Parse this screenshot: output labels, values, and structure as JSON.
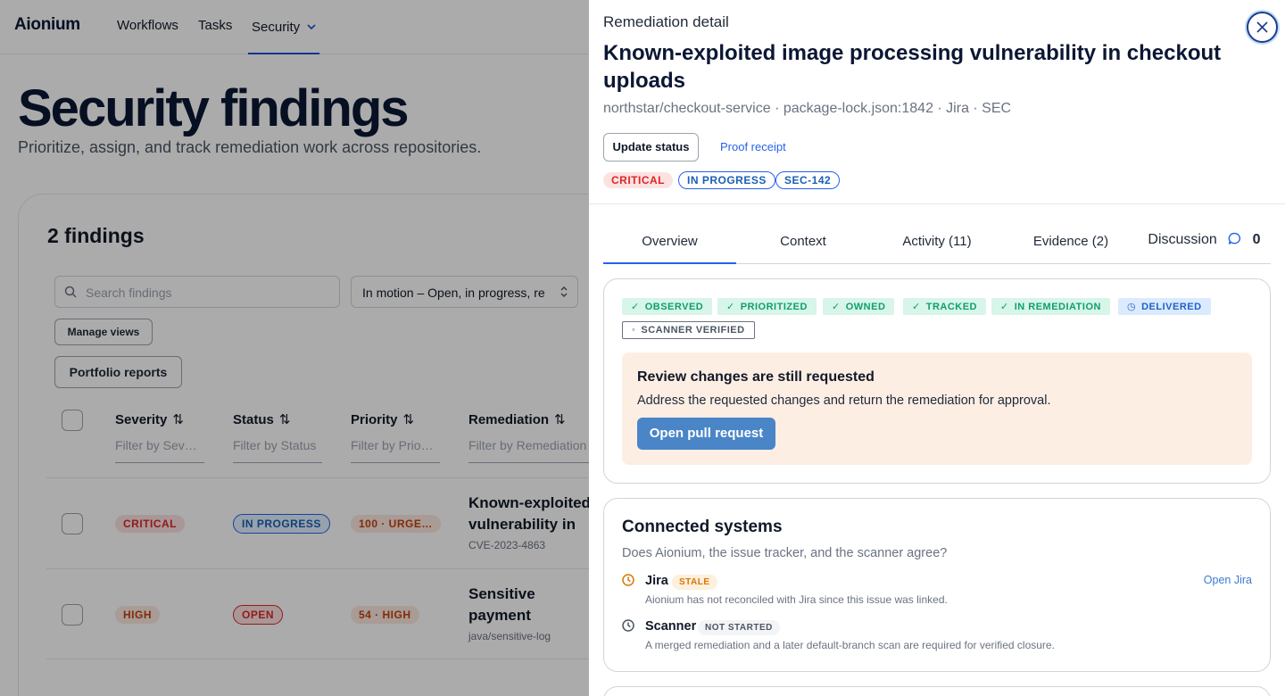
{
  "app": {
    "brand": "Aionium"
  },
  "nav": {
    "workflows": "Workflows",
    "tasks": "Tasks",
    "security": "Security"
  },
  "page": {
    "title": "Security findings",
    "subtitle": "Prioritize, assign, and track remediation work across repositories.",
    "count": "2 findings",
    "search_placeholder": "Search findings",
    "view_select": "In motion – Open, in progress, re",
    "manage_views": "Manage views",
    "portfolio_reports": "Portfolio reports"
  },
  "table": {
    "columns": [
      {
        "label": "Severity",
        "filter": "Filter by Sev…"
      },
      {
        "label": "Status",
        "filter": "Filter by Status"
      },
      {
        "label": "Priority",
        "filter": "Filter by Prio…"
      },
      {
        "label": "Remediation",
        "filter": "Filter by Remediation"
      }
    ],
    "sort_icon": "⇅",
    "rows": [
      {
        "severity": "CRITICAL",
        "status": "IN PROGRESS",
        "priority": "100 · URGE…",
        "title": "Known-exploited vulnerability in ch",
        "sub": "CVE-2023-4863"
      },
      {
        "severity": "HIGH",
        "status": "OPEN",
        "priority": "54 · HIGH",
        "title": "Sensitive payment production logs",
        "sub": "java/sensitive-log"
      }
    ]
  },
  "drawer": {
    "kicker": "Remediation detail",
    "title": "Known-exploited image processing vulnerability in checkout uploads",
    "meta": "northstar/checkout-service · package-lock.json:1842 · Jira · SEC",
    "update_status": "Update status",
    "proof_receipt": "Proof receipt",
    "chips": {
      "severity": "CRITICAL",
      "status": "IN PROGRESS",
      "ticket": "SEC-142"
    },
    "tabs": {
      "overview": "Overview",
      "context": "Context",
      "activity": "Activity (11)",
      "evidence": "Evidence (2)",
      "discussion": "Discussion",
      "discussion_count": "0"
    },
    "stages": {
      "observed": "OBSERVED",
      "prioritized": "PRIORITIZED",
      "owned": "OWNED",
      "tracked": "TRACKED",
      "in_remediation": "IN REMEDIATION",
      "delivered": "DELIVERED",
      "scanner_verified": "SCANNER VERIFIED"
    },
    "alert": {
      "title": "Review changes are still requested",
      "desc": "Address the requested changes and return the remediation for approval.",
      "button": "Open pull request"
    },
    "connected": {
      "title": "Connected systems",
      "question": "Does Aionium, the issue tracker, and the scanner agree?",
      "jira": {
        "name": "Jira",
        "badge": "STALE",
        "desc": "Aionium has not reconciled with Jira since this issue was linked.",
        "link": "Open Jira"
      },
      "scanner": {
        "name": "Scanner",
        "badge": "NOT STARTED",
        "desc": "A merged remediation and a later default-branch scan are required for verified closure."
      }
    }
  },
  "colors": {
    "accent": "#2563eb",
    "critical": "#dc2626",
    "success": "#0f9f6e",
    "warning": "#d97706"
  }
}
